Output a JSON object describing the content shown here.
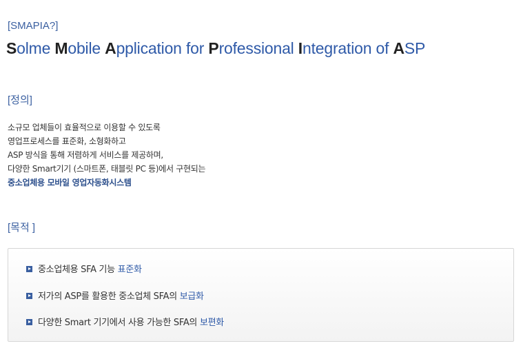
{
  "header": {
    "tag": "[SMAPIA?]",
    "title_words": [
      {
        "cap": "S",
        "rest": "olme "
      },
      {
        "cap": "M",
        "rest": "obile "
      },
      {
        "cap": "A",
        "rest": "pplication for "
      },
      {
        "cap": "P",
        "rest": "rofessional "
      },
      {
        "cap": "I",
        "rest": "ntegration of "
      },
      {
        "cap": "A",
        "rest": "SP"
      }
    ]
  },
  "definition": {
    "label": "[정의]",
    "lines": [
      "소규모 업체들이 효율적으로 이용할 수 있도록",
      "영업프로세스를 표준화, 소형화하고",
      "ASP 방식을 통해 저렴하게 서비스를 제공하며,",
      "다양한 Smart기기 (스마트폰, 태블릿 PC 등)에서 구현되는"
    ],
    "emphasis": "중소업체용 모바일 영업자동화시스템"
  },
  "purpose": {
    "label": "[목적 ]",
    "items": [
      {
        "text": "중소업체용 SFA 기능 ",
        "highlight": "표준화"
      },
      {
        "text": "저가의 ASP를 활용한 중소업체 SFA의 ",
        "highlight": "보급화"
      },
      {
        "text": "다양한 Smart 기기에서 사용 가능한 SFA의 ",
        "highlight": "보편화"
      }
    ]
  },
  "colors": {
    "accent_blue": "#2f5aa8",
    "dark_text": "#333333",
    "emphasis_navy": "#2c4f8c"
  }
}
